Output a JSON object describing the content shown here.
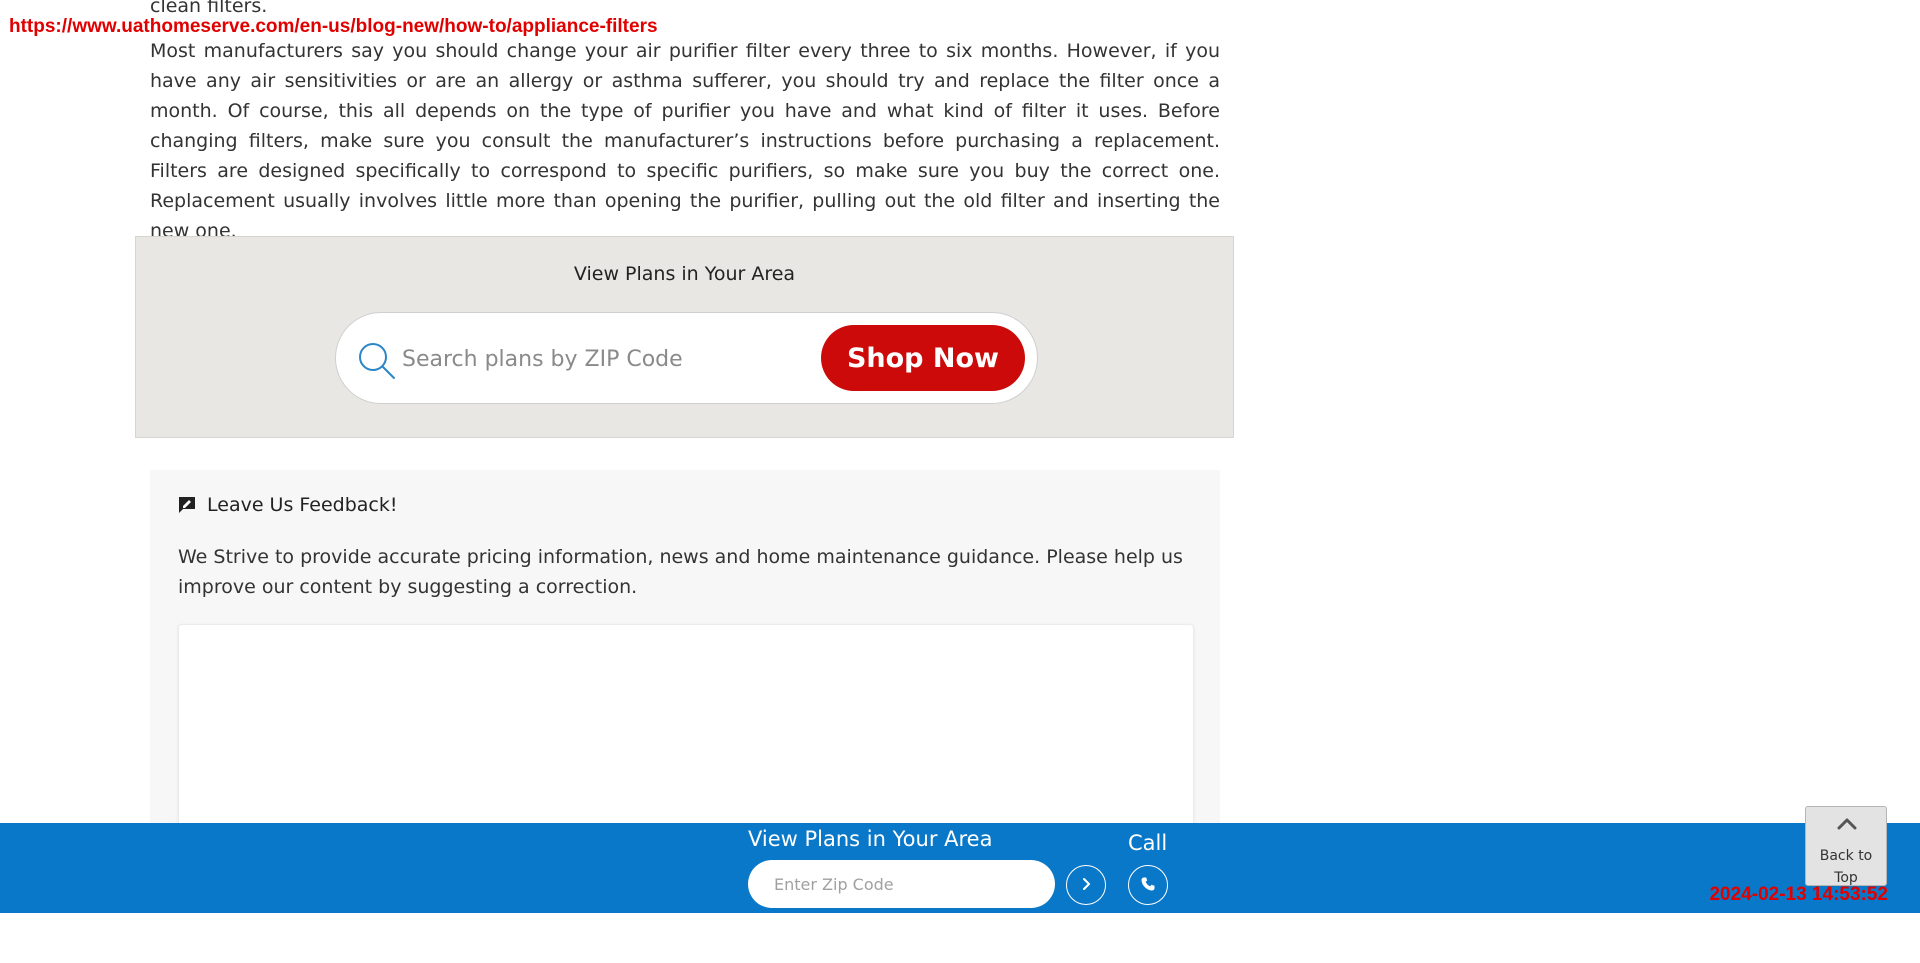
{
  "overlay": {
    "url": "https://www.uathomeserve.com/en-us/blog-new/how-to/appliance-filters",
    "timestamp": "2024-02-13 14:53:52"
  },
  "article": {
    "cut_line": "clean filters.",
    "paragraph": "Most manufacturers say you should change your air purifier filter every three to six months. However, if you have any air sensitivities or are an allergy or asthma sufferer, you should try and replace the filter once a month. Of course, this all depends on the type of purifier you have and what kind of filter it uses. Before changing filters, make sure you consult the manufacturer’s instructions before purchasing a replacement. Filters are designed specifically to correspond to specific purifiers, so make sure you buy the correct one. Replacement usually involves little more than opening the purifier, pulling out the old filter and inserting the new one."
  },
  "plans_search": {
    "title": "View Plans in Your Area",
    "placeholder": "Search plans by ZIP Code",
    "button_label": "Shop Now",
    "search_icon": "search-icon",
    "button_color": "#cc0a0a"
  },
  "feedback": {
    "title": "Leave Us Feedback!",
    "icon": "feedback-icon",
    "text": "We Strive to provide accurate pricing information, news and home maintenance guidance. Please help us improve our content by suggesting a correction."
  },
  "bottom_bar": {
    "title": "View Plans in Your Area",
    "zip_placeholder": "Enter Zip Code",
    "go_icon": "chevron-right-icon",
    "call_label": "Call",
    "phone_icon": "phone-icon",
    "bar_color": "#0a78c8"
  },
  "back_to_top": {
    "label": "Back to Top",
    "icon": "chevron-up-icon"
  }
}
